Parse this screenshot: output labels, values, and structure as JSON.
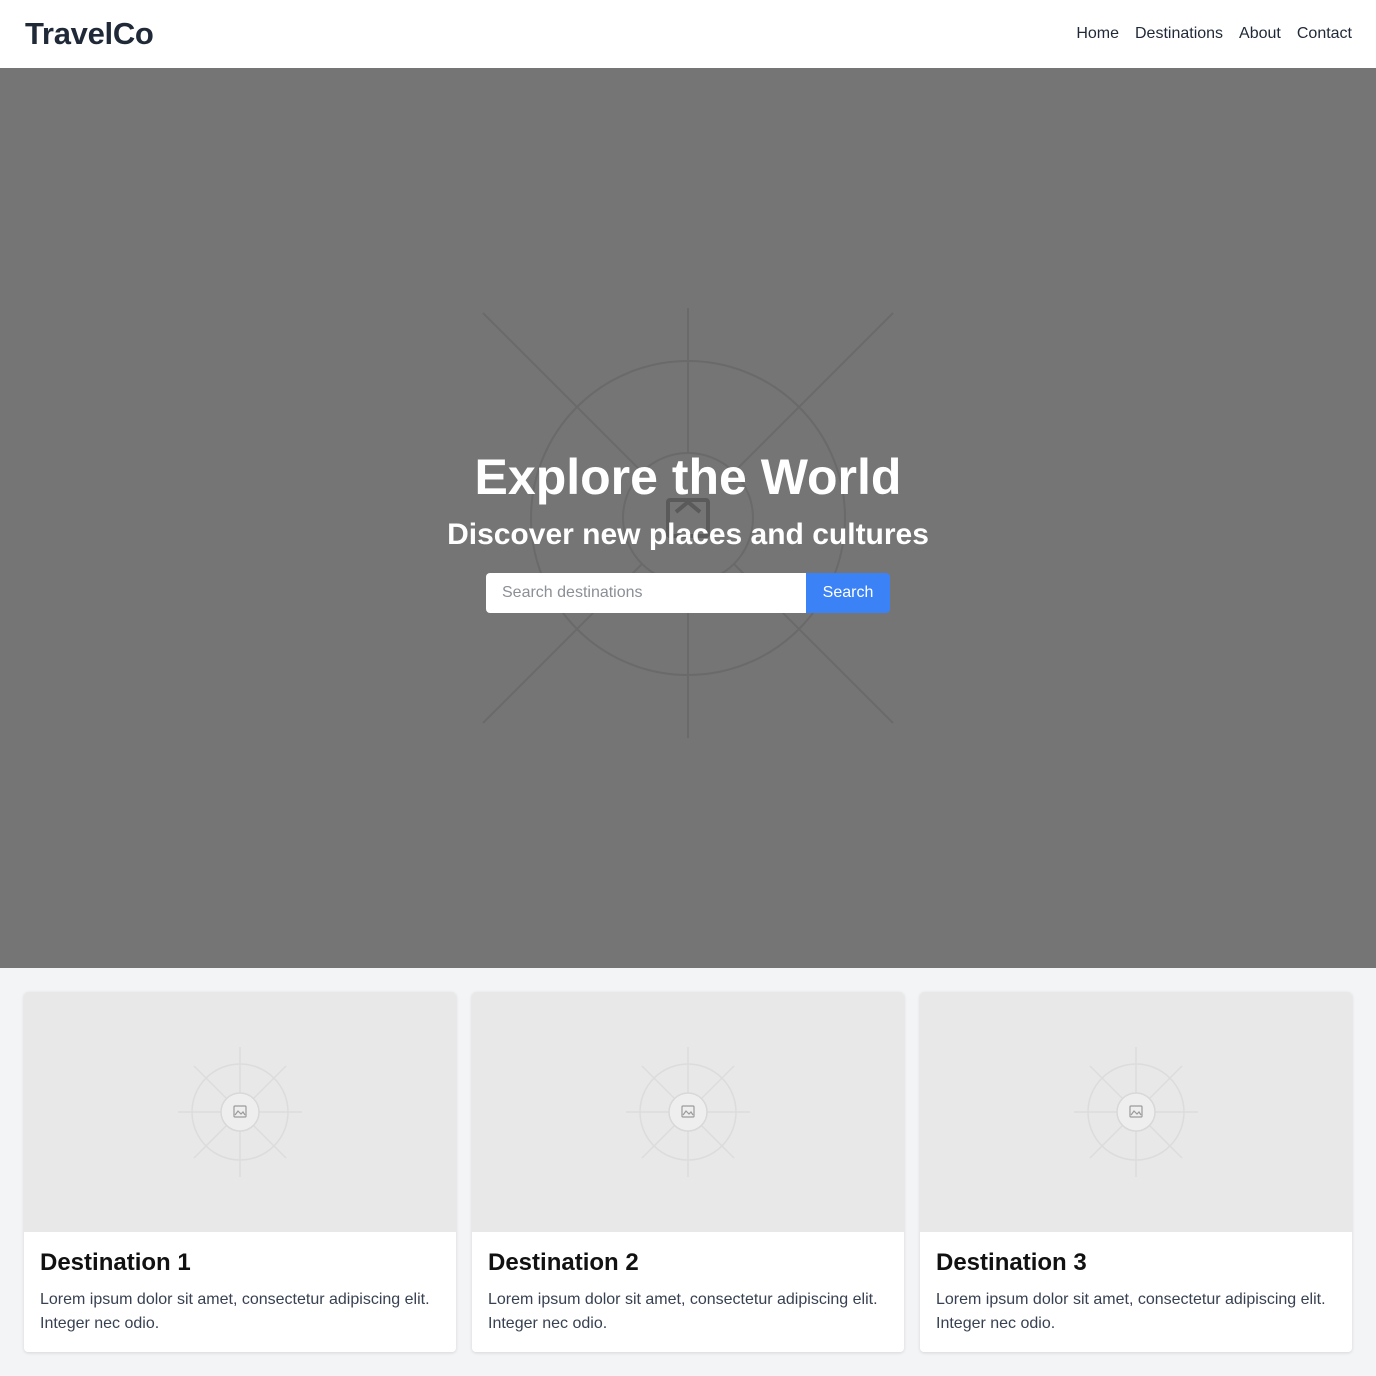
{
  "header": {
    "logo": "TravelCo",
    "nav": [
      {
        "label": "Home"
      },
      {
        "label": "Destinations"
      },
      {
        "label": "About"
      },
      {
        "label": "Contact"
      }
    ]
  },
  "hero": {
    "title": "Explore the World",
    "subtitle": "Discover new places and cultures",
    "search": {
      "placeholder": "Search destinations",
      "value": "",
      "button_label": "Search"
    },
    "background_icon": "image-placeholder-icon"
  },
  "destinations": [
    {
      "title": "Destination 1",
      "description": "Lorem ipsum dolor sit amet, consectetur adipiscing elit. Integer nec odio.",
      "image_icon": "image-placeholder-icon"
    },
    {
      "title": "Destination 2",
      "description": "Lorem ipsum dolor sit amet, consectetur adipiscing elit. Integer nec odio.",
      "image_icon": "image-placeholder-icon"
    },
    {
      "title": "Destination 3",
      "description": "Lorem ipsum dolor sit amet, consectetur adipiscing elit. Integer nec odio.",
      "image_icon": "image-placeholder-icon"
    }
  ],
  "colors": {
    "header_bg": "#ffffff",
    "hero_bg": "#757575",
    "accent": "#3b82f6",
    "page_bg": "#f3f4f6",
    "text_dark": "#1f2937"
  }
}
